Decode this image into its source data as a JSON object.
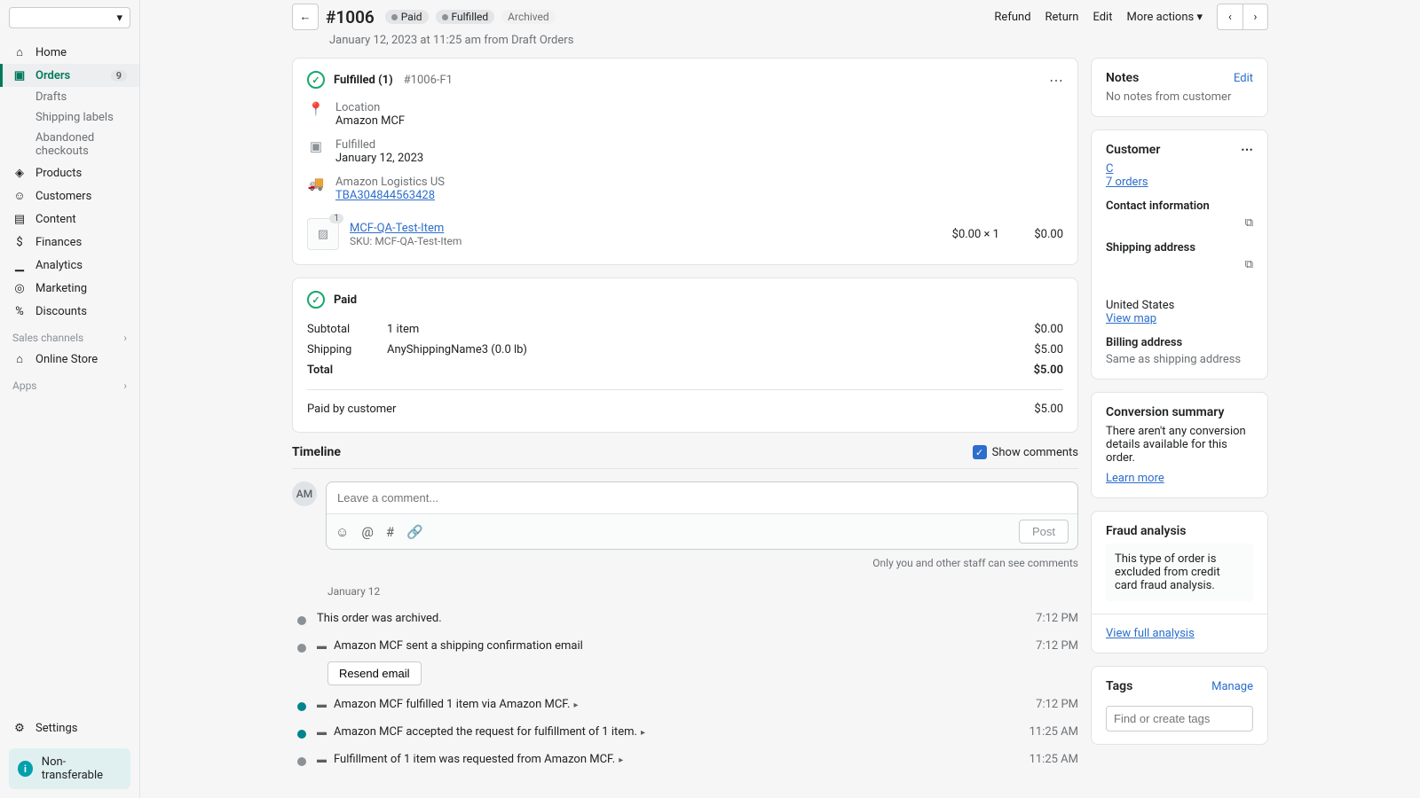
{
  "sidebar": {
    "items": [
      {
        "label": "Home"
      },
      {
        "label": "Orders",
        "badge": "9"
      },
      {
        "label": "Products"
      },
      {
        "label": "Customers"
      },
      {
        "label": "Content"
      },
      {
        "label": "Finances"
      },
      {
        "label": "Analytics"
      },
      {
        "label": "Marketing"
      },
      {
        "label": "Discounts"
      }
    ],
    "orderSub": [
      {
        "label": "Drafts"
      },
      {
        "label": "Shipping labels"
      },
      {
        "label": "Abandoned checkouts"
      }
    ],
    "salesChannels": "Sales channels",
    "onlineStore": "Online Store",
    "apps": "Apps",
    "settings": "Settings",
    "trial": "Non-transferable"
  },
  "header": {
    "orderId": "#1006",
    "badges": {
      "paid": "Paid",
      "fulfilled": "Fulfilled",
      "archived": "Archived"
    },
    "actions": {
      "refund": "Refund",
      "return": "Return",
      "edit": "Edit",
      "more": "More actions"
    },
    "date": "January 12, 2023 at 11:25 am from Draft Orders"
  },
  "fulfill": {
    "title": "Fulfilled (1)",
    "sub": "#1006-F1",
    "location": {
      "label": "Location",
      "value": "Amazon MCF"
    },
    "fulfilled": {
      "label": "Fulfilled",
      "value": "January 12, 2023"
    },
    "carrier": {
      "label": "Amazon Logistics US",
      "tracking": "TBA304844563428"
    },
    "item": {
      "count": "1",
      "name": "MCF-QA-Test-Item",
      "sku": "SKU: MCF-QA-Test-Item",
      "price": "$0.00 × 1",
      "total": "$0.00"
    }
  },
  "paid": {
    "title": "Paid",
    "subtotal": {
      "label": "Subtotal",
      "desc": "1 item",
      "amount": "$0.00"
    },
    "shipping": {
      "label": "Shipping",
      "desc": "AnyShippingName3 (0.0 lb)",
      "amount": "$5.00"
    },
    "total": {
      "label": "Total",
      "amount": "$5.00"
    },
    "paidBy": {
      "label": "Paid by customer",
      "amount": "$5.00"
    }
  },
  "timeline": {
    "title": "Timeline",
    "showComments": "Show comments",
    "avatar": "AM",
    "placeholder": "Leave a comment...",
    "post": "Post",
    "note": "Only you and other staff can see comments",
    "dateLabel": "January 12",
    "resend": "Resend email",
    "events": [
      {
        "text": "This order was archived.",
        "time": "7:12 PM"
      },
      {
        "text": "Amazon MCF sent a shipping confirmation email",
        "time": "7:12 PM",
        "expandable": true
      },
      {
        "text": "Amazon MCF fulfilled 1 item via Amazon MCF.",
        "time": "7:12 PM",
        "green": true,
        "expandable": true,
        "caret": true
      },
      {
        "text": "Amazon MCF accepted the request for fulfillment of 1 item.",
        "time": "11:25 AM",
        "green": true,
        "expandable": true,
        "caret": true
      },
      {
        "text": "Fulfillment of 1 item was requested from Amazon MCF.",
        "time": "11:25 AM",
        "expandable": true,
        "caret": true
      }
    ]
  },
  "side": {
    "notes": {
      "title": "Notes",
      "edit": "Edit",
      "body": "No notes from customer"
    },
    "customer": {
      "title": "Customer",
      "name": "C",
      "orders": "7 orders",
      "contact": "Contact information",
      "shipping": "Shipping address",
      "country": "United States",
      "viewMap": "View map",
      "billing": "Billing address",
      "billingBody": "Same as shipping address"
    },
    "conversion": {
      "title": "Conversion summary",
      "body": "There aren't any conversion details available for this order.",
      "learn": "Learn more"
    },
    "fraud": {
      "title": "Fraud analysis",
      "body": "This type of order is excluded from credit card fraud analysis.",
      "view": "View full analysis"
    },
    "tags": {
      "title": "Tags",
      "manage": "Manage",
      "placeholder": "Find or create tags"
    }
  }
}
